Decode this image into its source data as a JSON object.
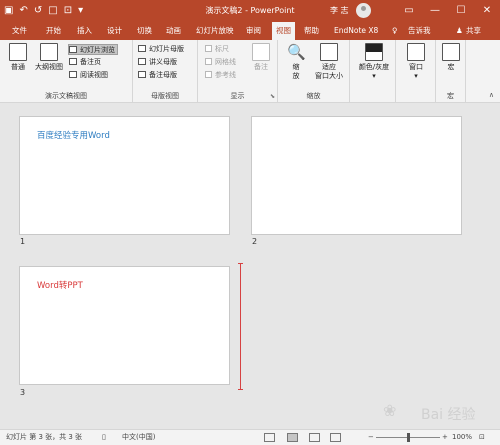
{
  "titlebar": {
    "title": "演示文稿2  -  PowerPoint",
    "user": "李 志",
    "qat": {
      "save_icon": "save-icon",
      "undo_icon": "undo-icon",
      "redo_icon": "redo-icon",
      "new_icon": "new-file-icon",
      "open_icon": "open-file-icon",
      "customize_icon": "customize-icon"
    },
    "window_buttons": {
      "options": "▭",
      "minimize": "—",
      "maximize": "☐",
      "close": "✕"
    },
    "bg_color": "#b7472a"
  },
  "tabs": {
    "file": "文件",
    "home": "开始",
    "insert": "插入",
    "design": "设计",
    "transitions": "切换",
    "animations": "动画",
    "slideshow": "幻灯片放映",
    "review": "审阅",
    "view": "视图",
    "help": "帮助",
    "endnote": "EndNote X8",
    "tell": "告诉我",
    "share": "共享"
  },
  "ribbon": {
    "presentation_views": {
      "label": "演示文稿视图",
      "normal": "普通",
      "outline": "大纲视图",
      "slide_sorter": "幻灯片浏览",
      "notes_page": "备注页",
      "reading_view": "阅读视图"
    },
    "master_views": {
      "label": "母版视图",
      "slide_master": "幻灯片母版",
      "handout_master": "讲义母版",
      "notes_master": "备注母版"
    },
    "show": {
      "label": "显示",
      "ruler": "标尺",
      "gridlines": "网格线",
      "guides": "参考线",
      "notes": "备注"
    },
    "zoom": {
      "label": "缩放",
      "zoom": "缩\n放",
      "fit": "适应\n窗口大小"
    },
    "color": {
      "label": "颜色/灰度"
    },
    "window": {
      "label": "窗口"
    },
    "macros": {
      "label": "宏",
      "macro": "宏"
    }
  },
  "slides": [
    {
      "number": "1",
      "text": "百度经验专用Word",
      "color": "#2e7dc1"
    },
    {
      "number": "2",
      "text": "",
      "color": "#2e7dc1"
    },
    {
      "number": "3",
      "text": "Word转PPT",
      "color": "#d93a3a"
    }
  ],
  "watermark": {
    "text": "Bai 经验",
    "paw": "❀"
  },
  "statusbar": {
    "slide_info": "幻灯片 第 3 张，共 3 张",
    "language": "中文(中国)",
    "zoom_minus": "−",
    "zoom_plus": "+",
    "zoom_level": "100%",
    "zoom_fraction": 0.5
  }
}
